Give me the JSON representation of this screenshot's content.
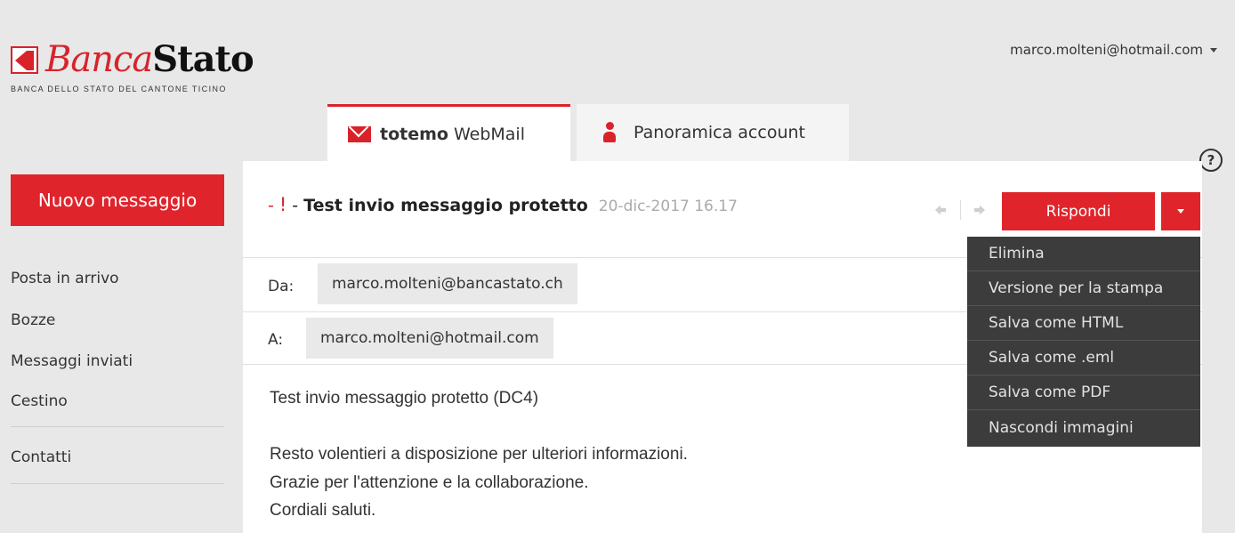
{
  "logo": {
    "part1": "Banca",
    "part2": "Stato",
    "subtitle": "BANCA DELLO STATO DEL CANTONE TICINO"
  },
  "user": {
    "email": "marco.molteni@hotmail.com"
  },
  "tabs": {
    "webmail_brand": "totemo",
    "webmail_product": "WebMail",
    "account": "Panoramica account"
  },
  "help": {
    "label": "?"
  },
  "sidebar": {
    "new_message": "Nuovo messaggio",
    "items": [
      "Posta in arrivo",
      "Bozze",
      "Messaggi inviati",
      "Cestino"
    ],
    "contacts": "Contatti"
  },
  "message": {
    "prefix": "-",
    "priority": "!",
    "separator": "-",
    "subject": "Test invio messaggio protetto",
    "date": "20-dic-2017 16.17",
    "from_label": "Da:",
    "from": "marco.molteni@bancastato.ch",
    "to_label": "A:",
    "to": "marco.molteni@hotmail.com",
    "body": [
      "Test invio messaggio protetto (DC4)",
      "Resto volentieri a disposizione per ulteriori informazioni.",
      "Grazie per l'attenzione e la collaborazione.",
      "Cordiali saluti."
    ]
  },
  "actions": {
    "reply": "Rispondi",
    "menu": [
      "Elimina",
      "Versione per la stampa",
      "Salva come HTML",
      "Salva come .eml",
      "Salva come PDF",
      "Nascondi immagini"
    ]
  },
  "colors": {
    "accent": "#e0242b",
    "menu_bg": "#3c3c3c",
    "background": "#e8e8e8"
  }
}
